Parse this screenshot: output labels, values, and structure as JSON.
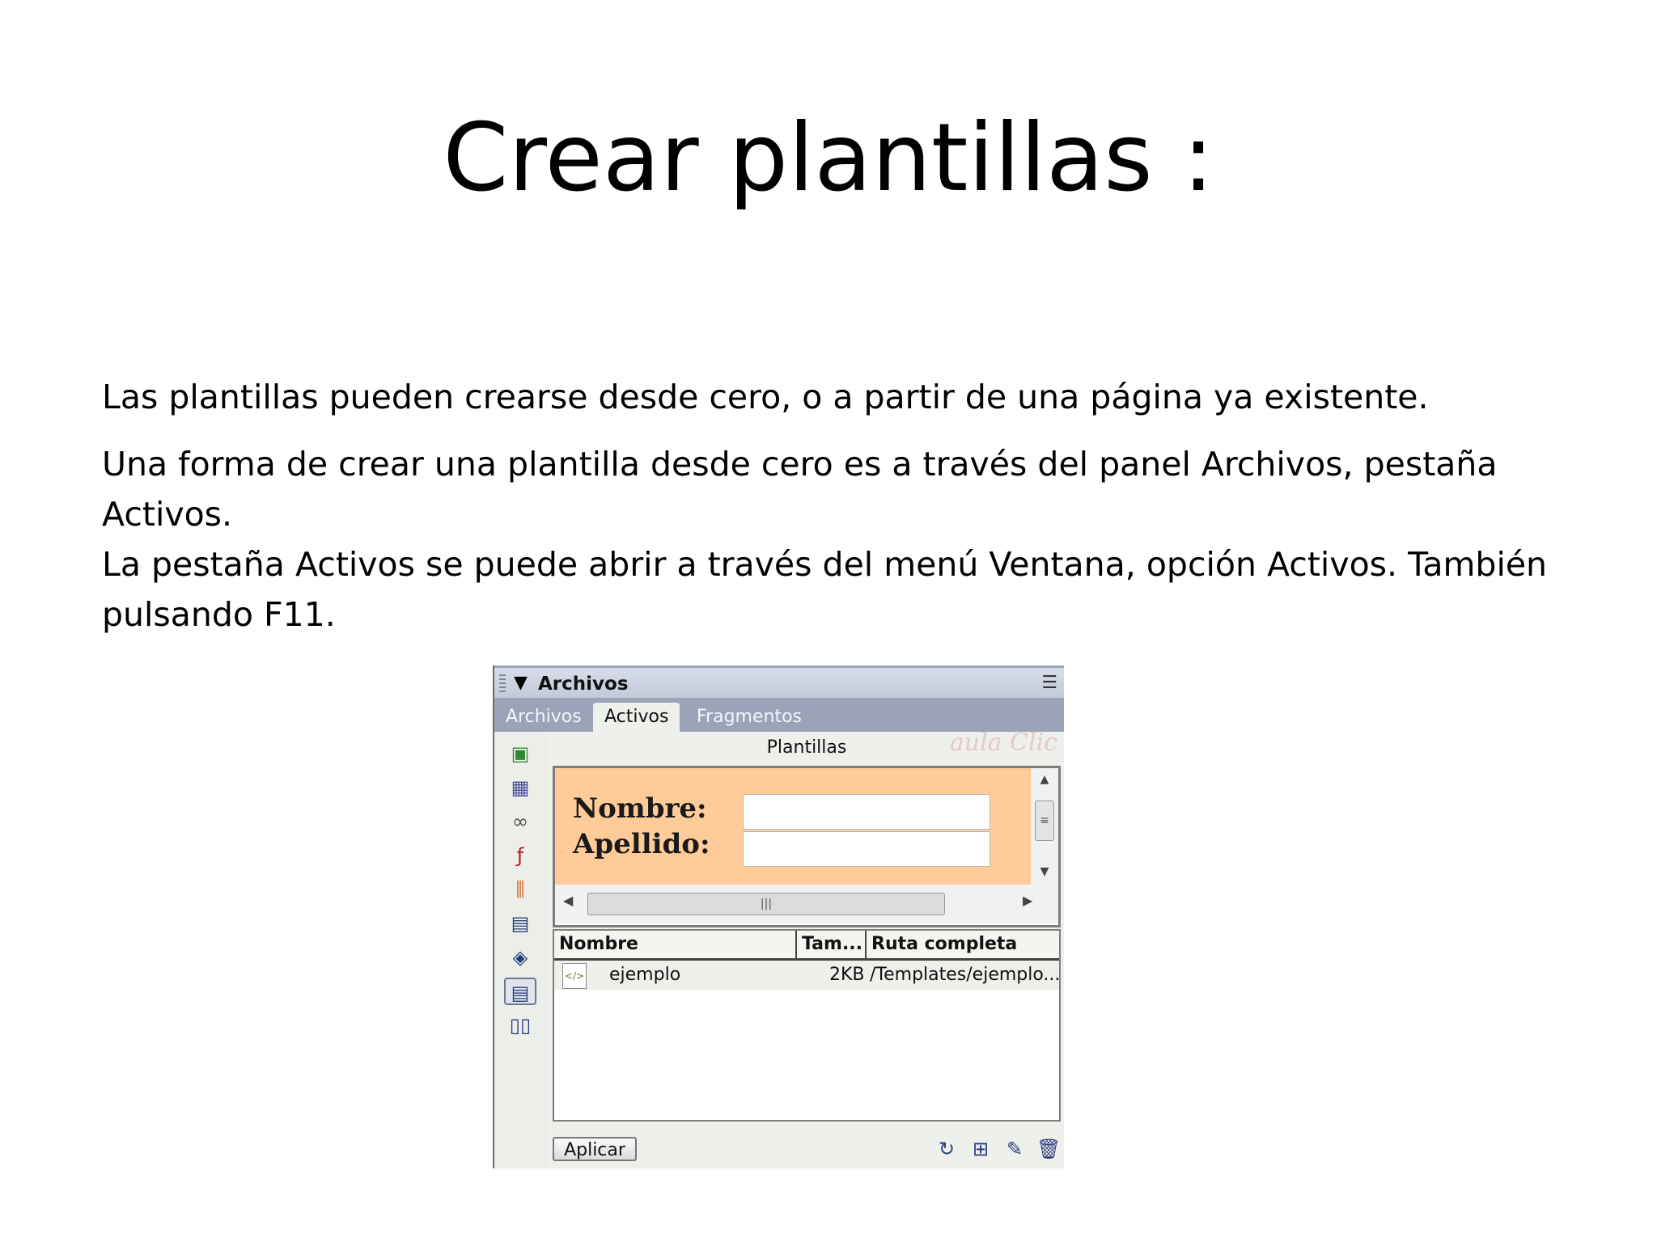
{
  "slide": {
    "title": "Crear plantillas :",
    "paragraph1": "Las plantillas pueden crearse desde cero, o a partir de una página ya existente.",
    "paragraph2": "Una forma de crear una plantilla desde cero es a través del panel Archivos, pestaña Activos.",
    "paragraph3": "La pestaña Activos se puede abrir a través del menú Ventana, opción Activos. También pulsando F11."
  },
  "panel": {
    "header_title": "Archivos",
    "tabs": [
      "Archivos",
      "Activos",
      "Fragmentos"
    ],
    "active_tab": "Activos",
    "section_label": "Plantillas",
    "watermark": "aula Clic",
    "sidebar_icons": [
      "image-icon",
      "color-grid-icon",
      "link-icon",
      "flash-icon",
      "shockwave-icon",
      "movie-icon",
      "script-icon",
      "template-icon",
      "library-icon"
    ],
    "selected_sidebar_icon": "template-icon",
    "preview": {
      "background": "#ffcc99",
      "label_nombre": "Nombre:",
      "label_apellido": "Apellido:"
    },
    "list": {
      "columns": [
        "Nombre",
        "Tam...",
        "Ruta completa"
      ],
      "rows": [
        {
          "name": "ejemplo",
          "size": "2KB",
          "path": "/Templates/ejemplo..."
        }
      ]
    },
    "apply_label": "Aplicar",
    "footer_icons": [
      "refresh-icon",
      "new-template-icon",
      "edit-icon",
      "delete-icon"
    ]
  }
}
